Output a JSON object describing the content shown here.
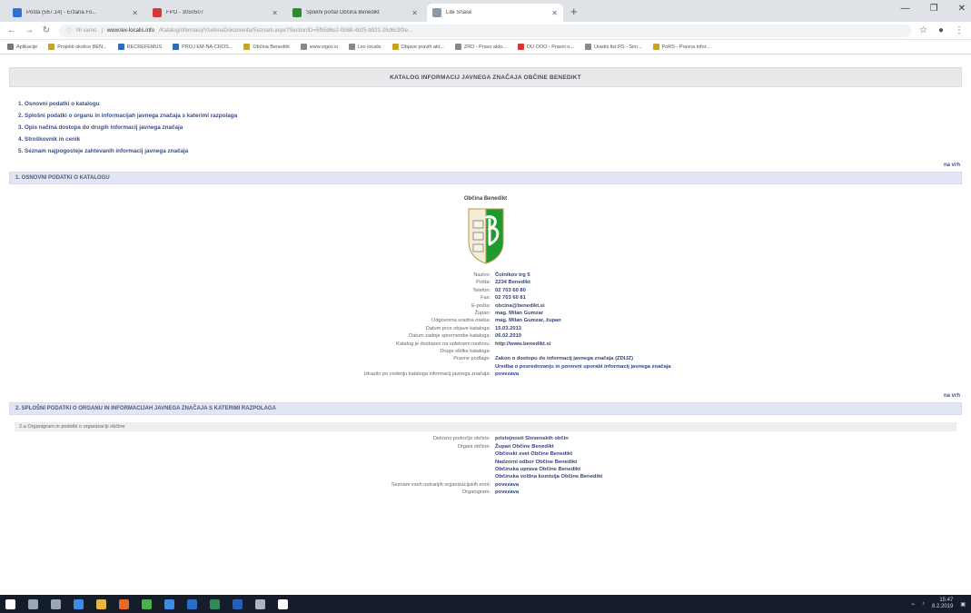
{
  "browser": {
    "tabs": [
      {
        "title": "Pošta (567.14) - Eržana Fo...",
        "color": "#2f6fd6"
      },
      {
        "title": "FPO - 3050507",
        "color": "#d23a3a"
      },
      {
        "title": "Spletni portal Občina Benedikt",
        "color": "#2d8c2d"
      },
      {
        "title": "Lite Snaše",
        "color": "#8899aa",
        "active": true
      }
    ],
    "url_prefix": "Ni varno",
    "url_domain": "www.lex-localis.info",
    "url_rest": "/KatalogInformacij/VsebinaDokumenta/Seznam.aspx?SectionID=5fb5d6e2-0b88-4b25-b921-26d6c9f3e..."
  },
  "bookmarks": [
    {
      "label": "Aplikacije",
      "color": "#777777"
    },
    {
      "label": "Projekti okolice BEN...",
      "color": "#c3a32a"
    },
    {
      "label": "RECREFEMUS",
      "color": "#2d6db8"
    },
    {
      "label": "PROJ EM-NA-CROS...",
      "color": "#2d6db8"
    },
    {
      "label": "Občina Benedikt",
      "color": "#c8a32a"
    },
    {
      "label": "www.sigov.si",
      "color": "#888888"
    },
    {
      "label": "Lex localis",
      "color": "#888888"
    },
    {
      "label": "Objave pravih akt...",
      "color": "#c8a32a"
    },
    {
      "label": "ZRD - Pravo akto...",
      "color": "#888888"
    },
    {
      "label": "DU OOO - Pravni o...",
      "color": "#d23a3a"
    },
    {
      "label": "Uradni list RS - Sim...",
      "color": "#888888"
    },
    {
      "label": "PoRS - Pravna infor...",
      "color": "#c8a32a"
    }
  ],
  "page": {
    "header": "KATALOG INFORMACIJ JAVNEGA ZNAČAJA OBČINE BENEDIKT",
    "toc": [
      "1. Osnovni podatki o katalogu",
      "2. Splošni podatki o organu in informacijah javnega značaja s katerimi razpolaga",
      "3. Opis načina dostopa do drugih informacij javnega značaja",
      "4. Stroškovnik in cenik",
      "5. Seznam najpogosteje zahtevanih informacij javnega značaja"
    ],
    "na_vrh": "na vrh",
    "sec1_title": "1. OSNOVNI PODATKI O KATALOGU",
    "municipality": "Občina Benedikt",
    "details": [
      {
        "k": "Naslov:",
        "v": "Čolnikov trg 5"
      },
      {
        "k": "Pošta:",
        "v": "2234 Benedikt"
      },
      {
        "k": "Telefon:",
        "v": "02 703 60 80"
      },
      {
        "k": "Fax:",
        "v": "02 703 60 81"
      },
      {
        "k": "E-pošta:",
        "v": "obcina@benedikt.si"
      },
      {
        "k": "Župan:",
        "v": "mag. Milan Gumzar"
      },
      {
        "k": "Odgovorna uradna oseba:",
        "v": "mag. Milan Gumzar, župan"
      },
      {
        "k": "Datum prve objave kataloga:",
        "v": "15.03.2013"
      },
      {
        "k": "Datum zadnje spremembe kataloga:",
        "v": "06.02.2019"
      },
      {
        "k": "Katalog je dostopen na spletnem naslovu:",
        "v": "http://www.benedikt.si"
      },
      {
        "k": "Druge oblike kataloga:",
        "v": ""
      },
      {
        "k": "Pravne podlage:",
        "v": "Zakon o dostopu do informacij javnega značaja (ZDIJZ)"
      },
      {
        "k": "",
        "v": "Uredba o posredovanju in ponovni uporabi informacij javnega značaja"
      },
      {
        "k": "Izkazilo po vodenju kataloga informacij javnega značaja:",
        "v": "povezava"
      }
    ],
    "sec2_title": "2. SPLOŠNI PODATKI O ORGANU IN INFORMACIJAH JAVNEGA ZNAČAJA S KATERIMI RAZPOLAGA",
    "sub21": "2.a Organigram in podatki o organizaciji občine",
    "org": [
      {
        "k": "Delovno področje občine:",
        "v": "pristojnosti Slovenskih občin"
      },
      {
        "k": "Organi občine:",
        "v": "Župan Občine Benedikt"
      },
      {
        "k": "",
        "v": "Občinski svet Občine Benedikt"
      },
      {
        "k": "",
        "v": "Nadzorni odbor Občine Benedikt"
      },
      {
        "k": "",
        "v": "Občinska uprava Občine Benedikt"
      },
      {
        "k": "",
        "v": "Občinska volilna komisija Občine Benedikt"
      },
      {
        "k": "Seznam vseh notranjih organizacijskih enot:",
        "v": "povezava"
      },
      {
        "k": "Organigram:",
        "v": "povezava"
      }
    ]
  },
  "window": {
    "min": "—",
    "max": "❐",
    "close": "✕"
  },
  "taskbar": {
    "icons": [
      {
        "name": "windows-start-icon",
        "color": "#ffffff"
      },
      {
        "name": "search-icon",
        "color": "#9aa6b8"
      },
      {
        "name": "task-view-icon",
        "color": "#9aa6b8"
      },
      {
        "name": "chrome-icon",
        "color": "#3d8be5"
      },
      {
        "name": "file-explorer-icon",
        "color": "#e8b640"
      },
      {
        "name": "firefox-icon",
        "color": "#e86a2a"
      },
      {
        "name": "chrome-icon-2",
        "color": "#4caf50"
      },
      {
        "name": "edge-icon",
        "color": "#3d8be5"
      },
      {
        "name": "outlook-icon",
        "color": "#2a6cc8"
      },
      {
        "name": "excel-icon",
        "color": "#2e8b57"
      },
      {
        "name": "word-icon",
        "color": "#2a5cb8"
      },
      {
        "name": "calculator-icon",
        "color": "#aab4c4"
      },
      {
        "name": "photos-icon",
        "color": "#ffffff"
      }
    ],
    "time": "15:47",
    "date": "8.2.2019"
  }
}
